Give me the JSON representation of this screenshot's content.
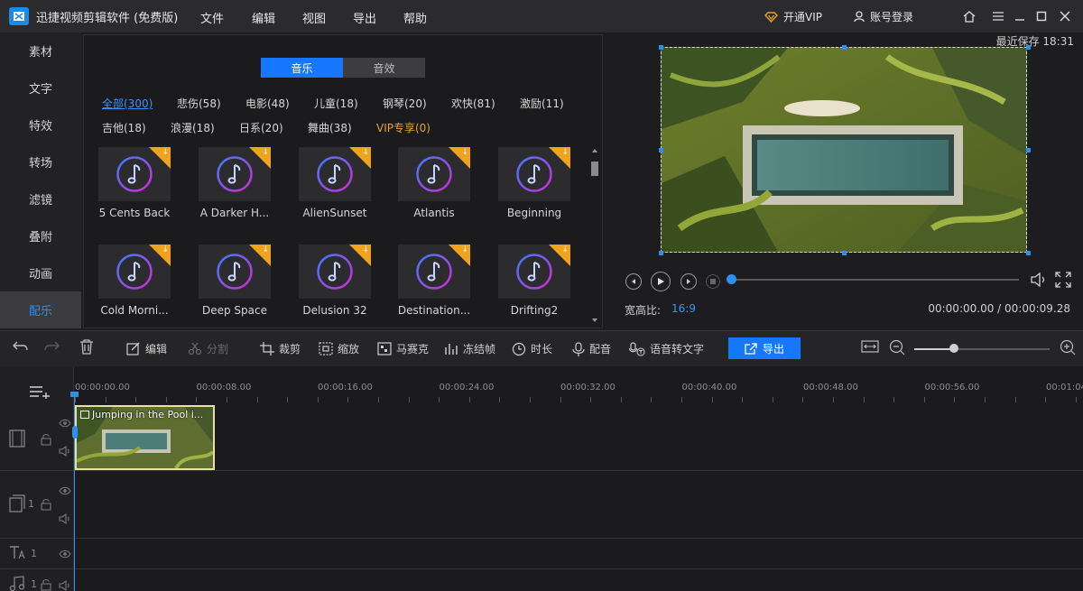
{
  "app": {
    "title": "迅捷视频剪辑软件 (免费版)"
  },
  "menu": [
    "文件",
    "编辑",
    "视图",
    "导出",
    "帮助"
  ],
  "topbar": {
    "vip": "开通VIP",
    "account": "账号登录"
  },
  "sidebar": [
    "素材",
    "文字",
    "特效",
    "转场",
    "滤镜",
    "叠附",
    "动画",
    "配乐"
  ],
  "library": {
    "tabs": [
      "音乐",
      "音效"
    ],
    "categories": [
      "全部(300)",
      "悲伤(58)",
      "电影(48)",
      "儿童(18)",
      "钢琴(20)",
      "欢快(81)",
      "激励(11)",
      "吉他(18)",
      "浪漫(18)",
      "日系(20)",
      "舞曲(38)",
      "VIP专享(0)"
    ],
    "items": [
      "5 Cents Back",
      "A Darker H...",
      "AlienSunset",
      "Atlantis",
      "Beginning",
      "Cold Morni...",
      "Deep Space",
      "Delusion 32",
      "Destination...",
      "Drifting2"
    ]
  },
  "preview": {
    "last_saved": "最近保存 18:31",
    "aspect_label": "宽高比:",
    "aspect_value": "16:9",
    "timecode": "00:00:00.00 / 00:00:09.28",
    "progress": 0.0
  },
  "toolbar": {
    "edit": "编辑",
    "split": "分割",
    "crop": "裁剪",
    "zoom": "缩放",
    "mosaic": "马赛克",
    "freeze": "冻结帧",
    "duration": "时长",
    "dub": "配音",
    "speech_to_text": "语音转文字",
    "export": "导出",
    "zoom_level": 0.29
  },
  "timeline": {
    "ruler": [
      "00:00:00.00",
      "00:00:08.00",
      "00:00:16.00",
      "00:00:24.00",
      "00:00:32.00",
      "00:00:40.00",
      "00:00:48.00",
      "00:00:56.00",
      "00:01:04"
    ],
    "clip_label": "Jumping in the Pool i...",
    "track_numbers": [
      "1",
      "1",
      "1"
    ]
  }
}
